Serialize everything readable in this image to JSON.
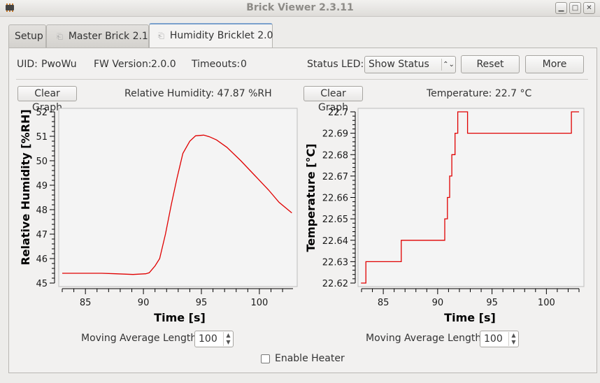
{
  "window": {
    "title": "Brick Viewer 2.3.11",
    "controls": [
      "minimize",
      "maximize",
      "close"
    ]
  },
  "tabs": [
    {
      "label": "Setup",
      "icon": null,
      "active": false
    },
    {
      "label": "Master Brick 2.1",
      "icon": "detach-icon",
      "active": false
    },
    {
      "label": "Humidity Bricklet 2.0",
      "icon": "detach-icon",
      "active": true
    }
  ],
  "info": {
    "uid_label": "UID:",
    "uid_value": "PwoWu",
    "fw_label": "FW Version:",
    "fw_value": "2.0.0",
    "timeouts_label": "Timeouts:",
    "timeouts_value": "0",
    "status_led_label": "Status LED:",
    "status_led_value": "Show Status",
    "reset_label": "Reset",
    "more_label": "More"
  },
  "humidity_panel": {
    "clear_label": "Clear Graph",
    "readout": "Relative Humidity: 47.87 %RH",
    "moving_avg_label": "Moving Average Length:",
    "moving_avg_value": "100"
  },
  "temperature_panel": {
    "clear_label": "Clear Graph",
    "readout": "Temperature: 22.7 °C",
    "moving_avg_label": "Moving Average Length:",
    "moving_avg_value": "100"
  },
  "heater": {
    "label": "Enable Heater",
    "checked": false
  },
  "colors": {
    "line": "#e00000",
    "tab_accent": "#7aa0cc"
  },
  "chart_data": [
    {
      "type": "line",
      "title": "",
      "xlabel": "Time [s]",
      "ylabel": "Relative Humidity [%RH]",
      "xlim": [
        83,
        103
      ],
      "ylim": [
        45,
        52
      ],
      "xticks": [
        85,
        90,
        95,
        100
      ],
      "yticks": [
        45,
        46,
        47,
        48,
        49,
        50,
        51,
        52
      ],
      "grid": false,
      "series": [
        {
          "name": "Relative Humidity",
          "x": [
            83.0,
            86.4,
            87.6,
            89.1,
            90.2,
            90.5,
            91.0,
            91.4,
            91.9,
            92.4,
            92.9,
            93.4,
            94.0,
            94.5,
            95.2,
            95.7,
            96.3,
            97.2,
            98.4,
            99.6,
            100.8,
            101.7,
            102.8
          ],
          "y": [
            45.4,
            45.4,
            45.38,
            45.35,
            45.38,
            45.42,
            45.7,
            46.0,
            47.0,
            48.2,
            49.3,
            50.3,
            50.8,
            51.02,
            51.05,
            50.98,
            50.85,
            50.55,
            50.0,
            49.4,
            48.8,
            48.3,
            47.87
          ]
        }
      ]
    },
    {
      "type": "line",
      "title": "",
      "xlabel": "Time [s]",
      "ylabel": "Temperature [°C]",
      "xlim": [
        83,
        103
      ],
      "ylim": [
        22.62,
        22.7
      ],
      "xticks": [
        85,
        90,
        95,
        100
      ],
      "yticks": [
        22.62,
        22.63,
        22.64,
        22.65,
        22.66,
        22.67,
        22.68,
        22.69,
        22.7
      ],
      "grid": false,
      "step": true,
      "series": [
        {
          "name": "Temperature",
          "x": [
            82.95,
            83.4,
            86.65,
            90.65,
            90.9,
            91.1,
            91.3,
            91.6,
            91.85,
            92.05,
            92.75,
            102.3,
            103.0
          ],
          "y": [
            22.62,
            22.63,
            22.64,
            22.65,
            22.66,
            22.67,
            22.68,
            22.69,
            22.7,
            22.7,
            22.69,
            22.7,
            22.7
          ]
        }
      ]
    }
  ]
}
